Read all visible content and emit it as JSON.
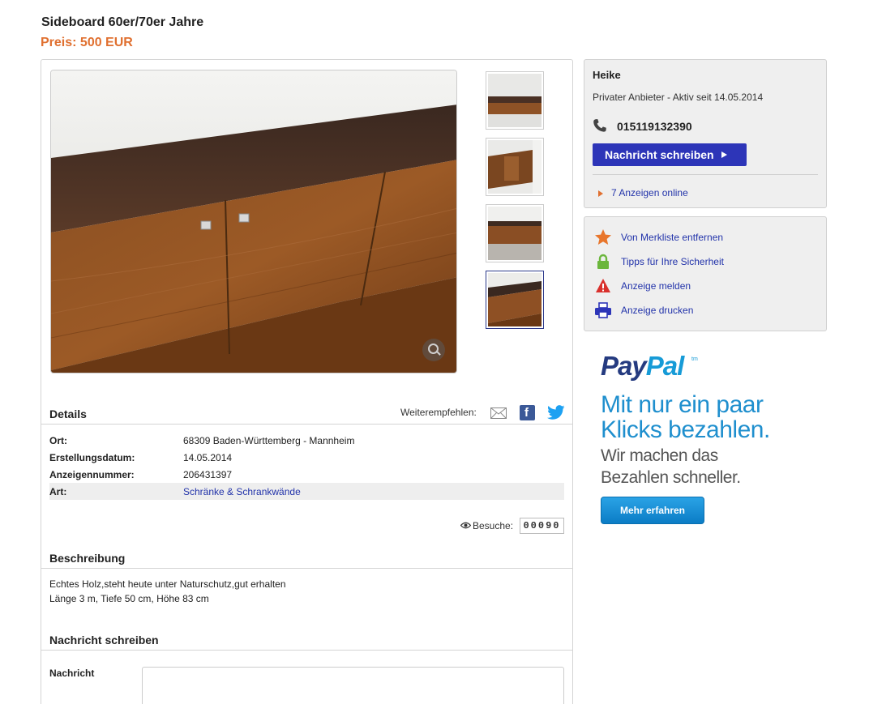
{
  "listing": {
    "title": "Sideboard 60er/70er Jahre",
    "price": "Preis: 500 EUR"
  },
  "details": {
    "heading": "Details",
    "share_label": "Weiterempfehlen:",
    "rows": [
      {
        "key": "Ort:",
        "value": "68309 Baden-Württemberg - Mannheim"
      },
      {
        "key": "Erstellungsdatum:",
        "value": "14.05.2014"
      },
      {
        "key": "Anzeigennummer:",
        "value": "206431397"
      },
      {
        "key": "Art:",
        "value": "Schränke & Schrankwände"
      }
    ],
    "visits_label": "Besuche:",
    "visits_count": "00090"
  },
  "description": {
    "heading": "Beschreibung",
    "lines": [
      "Echtes Holz,steht heute unter Naturschutz,gut erhalten",
      "Länge 3 m, Tiefe 50 cm, Höhe 83 cm"
    ]
  },
  "contact_form": {
    "heading": "Nachricht schreiben",
    "message_label": "Nachricht",
    "message_value": ""
  },
  "seller": {
    "name": "Heike",
    "since": "Privater Anbieter - Aktiv seit 14.05.2014",
    "phone": "015119132390",
    "message_button": "Nachricht schreiben",
    "ads_online": "7 Anzeigen online"
  },
  "actions": [
    {
      "label": "Von Merkliste entfernen",
      "icon": "star-icon",
      "color": "#e8762c"
    },
    {
      "label": "Tipps für Ihre Sicherheit",
      "icon": "lock-icon",
      "color": "#6bb63c"
    },
    {
      "label": "Anzeige melden",
      "icon": "warning-icon",
      "color": "#d9302c"
    },
    {
      "label": "Anzeige drucken",
      "icon": "printer-icon",
      "color": "#2d35b8"
    }
  ],
  "paypal_ad": {
    "logo_pay": "Pay",
    "logo_pal": "Pal",
    "logo_tm": "tm",
    "headline_1": "Mit nur ein paar",
    "headline_2": "Klicks bezahlen.",
    "sub_1": "Wir machen das",
    "sub_2": "Bezahlen schneller.",
    "button": "Mehr erfahren"
  },
  "colors": {
    "price": "#e07030",
    "link": "#2233aa",
    "button": "#2d35b8",
    "paypal_dark": "#253b80",
    "paypal_light": "#179bd7"
  }
}
